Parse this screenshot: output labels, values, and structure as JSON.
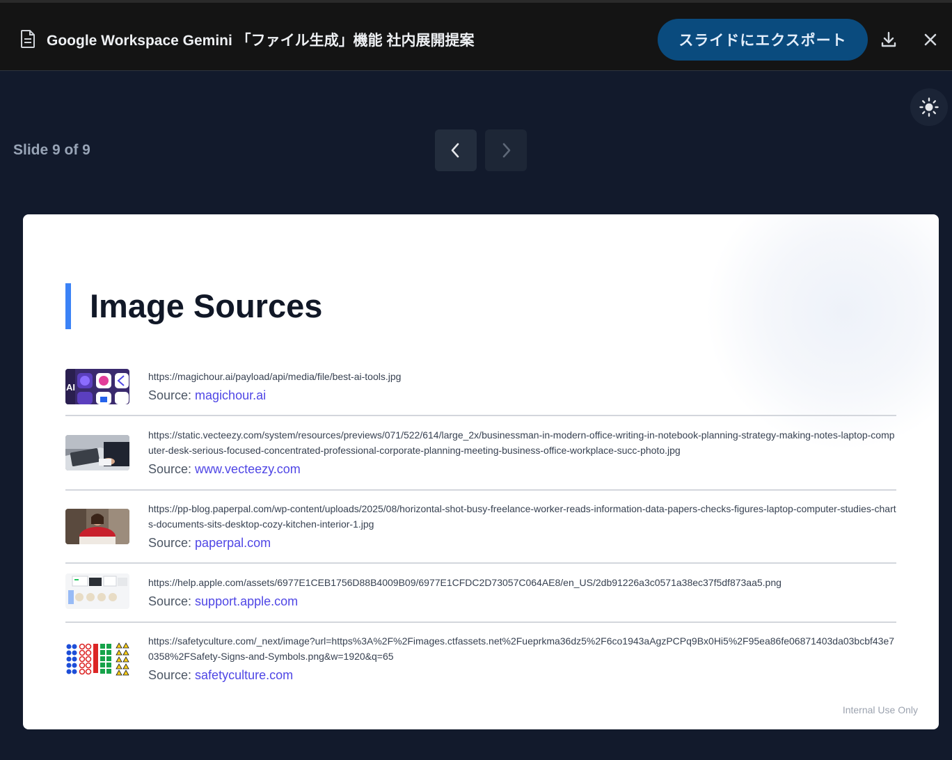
{
  "header": {
    "doc_icon": "document-icon",
    "title": "Google Workspace Gemini 「ファイル生成」機能 社内展開提案",
    "export_label": "スライドにエクスポート",
    "download_icon": "download-icon",
    "close_icon": "close-icon"
  },
  "toolbar": {
    "theme_icon": "sun-icon",
    "slide_counter": "Slide 9 of 9",
    "prev_icon": "chevron-left-icon",
    "next_icon": "chevron-right-icon"
  },
  "slide": {
    "title": "Image Sources",
    "source_prefix": "Source: ",
    "sources": [
      {
        "url": "https://magichour.ai/payload/api/media/file/best-ai-tools.jpg",
        "label": "magichour.ai"
      },
      {
        "url": "https://static.vecteezy.com/system/resources/previews/071/522/614/large_2x/businessman-in-modern-office-writing-in-notebook-planning-strategy-making-notes-laptop-computer-desk-serious-focused-concentrated-professional-corporate-planning-meeting-business-office-workplace-succ-photo.jpg",
        "label": "www.vecteezy.com"
      },
      {
        "url": "https://pp-blog.paperpal.com/wp-content/uploads/2025/08/horizontal-shot-busy-freelance-worker-reads-information-data-papers-checks-figures-laptop-computer-studies-charts-documents-sits-desktop-cozy-kitchen-interior-1.jpg",
        "label": "paperpal.com"
      },
      {
        "url": "https://help.apple.com/assets/6977E1CEB1756D88B4009B09/6977E1CFDC2D73057C064AE8/en_US/2db91226a3c0571a38ec37f5df873aa5.png",
        "label": "support.apple.com"
      },
      {
        "url": "https://safetyculture.com/_next/image?url=https%3A%2F%2Fimages.ctfassets.net%2Fueprkma36dz5%2F6co1943aAgzPCPq9Bx0Hi5%2F95ea86fe06871403da03bcbf43e70358%2FSafety-Signs-and-Symbols.png&w=1920&q=65",
        "label": "safetyculture.com"
      }
    ],
    "footer_note": "Internal Use Only"
  },
  "colors": {
    "page_bg": "#121a2c",
    "topbar_bg": "#141414",
    "export_btn": "#0a4b7e",
    "accent_bar": "#3b82f6",
    "link": "#4f46e5"
  }
}
